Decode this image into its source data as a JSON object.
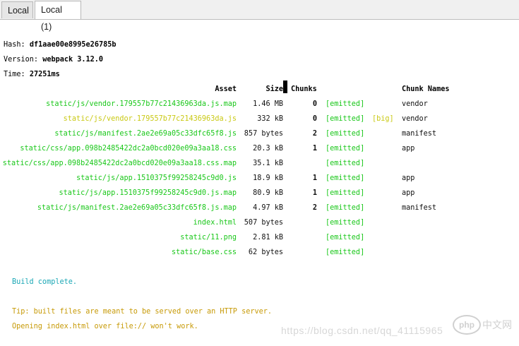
{
  "tabs": [
    {
      "label": "Local"
    },
    {
      "label": "Local (1)"
    }
  ],
  "header": {
    "hash_label": "Hash: ",
    "hash_value": "df1aae00e8995e26785b",
    "version_label": "Version: ",
    "version_value": "webpack 3.12.0",
    "time_label": "Time: ",
    "time_value": "27251ms"
  },
  "table": {
    "columns": {
      "asset": "Asset",
      "size": "Size",
      "chunks": "Chunks",
      "chunk_names": "Chunk Names"
    },
    "rows": [
      {
        "asset": "static/js/vendor.179557b77c21436963da.js.map",
        "size": "1.46 MB",
        "chunks": "0",
        "status": "[emitted]",
        "flag": "",
        "names": "vendor",
        "color": "green"
      },
      {
        "asset": "static/js/vendor.179557b77c21436963da.js",
        "size": "332 kB",
        "chunks": "0",
        "status": "[emitted]",
        "flag": "[big]",
        "names": "vendor",
        "color": "yellow"
      },
      {
        "asset": "static/js/manifest.2ae2e69a05c33dfc65f8.js",
        "size": "857 bytes",
        "chunks": "2",
        "status": "[emitted]",
        "flag": "",
        "names": "manifest",
        "color": "green"
      },
      {
        "asset": "static/css/app.098b2485422dc2a0bcd020e09a3aa18.css",
        "size": "20.3 kB",
        "chunks": "1",
        "status": "[emitted]",
        "flag": "",
        "names": "app",
        "color": "green"
      },
      {
        "asset": "static/css/app.098b2485422dc2a0bcd020e09a3aa18.css.map",
        "size": "35.1 kB",
        "chunks": "",
        "status": "[emitted]",
        "flag": "",
        "names": "",
        "color": "green"
      },
      {
        "asset": "static/js/app.1510375f99258245c9d0.js",
        "size": "18.9 kB",
        "chunks": "1",
        "status": "[emitted]",
        "flag": "",
        "names": "app",
        "color": "green"
      },
      {
        "asset": "static/js/app.1510375f99258245c9d0.js.map",
        "size": "80.9 kB",
        "chunks": "1",
        "status": "[emitted]",
        "flag": "",
        "names": "app",
        "color": "green"
      },
      {
        "asset": "static/js/manifest.2ae2e69a05c33dfc65f8.js.map",
        "size": "4.97 kB",
        "chunks": "2",
        "status": "[emitted]",
        "flag": "",
        "names": "manifest",
        "color": "green"
      },
      {
        "asset": "index.html",
        "size": "507 bytes",
        "chunks": "",
        "status": "[emitted]",
        "flag": "",
        "names": "",
        "color": "green"
      },
      {
        "asset": "static/11.png",
        "size": "2.81 kB",
        "chunks": "",
        "status": "[emitted]",
        "flag": "",
        "names": "",
        "color": "green"
      },
      {
        "asset": "static/base.css",
        "size": "62 bytes",
        "chunks": "",
        "status": "[emitted]",
        "flag": "",
        "names": "",
        "color": "green"
      }
    ]
  },
  "messages": {
    "build_complete": "Build complete.",
    "tip_line1": "Tip: built files are meant to be served over an HTTP server.",
    "tip_line2": "Opening index.html over file:// won't work."
  },
  "watermark": {
    "url": "https://blog.csdn.net/qq_41115965",
    "logo_php": "php",
    "logo_cn": "中文网"
  },
  "colors": {
    "green": "#19c719",
    "yellow": "#c9c913",
    "cyan": "#1aa7b5",
    "orange": "#c79a07"
  }
}
